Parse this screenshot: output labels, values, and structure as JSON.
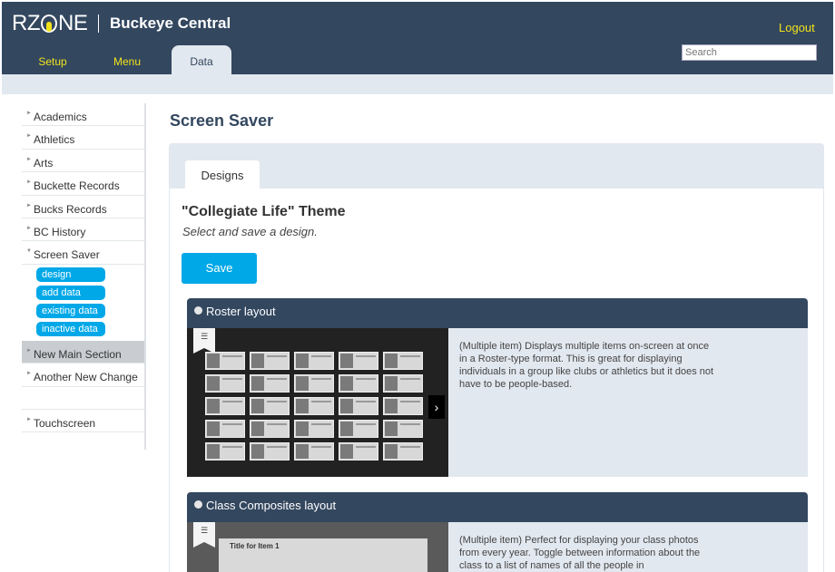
{
  "header": {
    "logo_text": "RZONE",
    "site_title": "Buckeye Central",
    "logout_label": "Logout",
    "search_placeholder": "Search",
    "tabs": [
      {
        "label": "Setup",
        "active": false
      },
      {
        "label": "Menu",
        "active": false
      },
      {
        "label": "Data",
        "active": true
      }
    ],
    "accent_color": "#f2e31b",
    "bar_color": "#33475f"
  },
  "sidebar": {
    "items": [
      {
        "label": "Academics"
      },
      {
        "label": "Athletics"
      },
      {
        "label": "Arts"
      },
      {
        "label": "Buckette Records"
      },
      {
        "label": "Bucks Records"
      },
      {
        "label": "BC History"
      },
      {
        "label": "Screen Saver"
      }
    ],
    "subitems": [
      {
        "label": "design"
      },
      {
        "label": "add data"
      },
      {
        "label": "existing data"
      },
      {
        "label": "inactive data"
      }
    ],
    "after_items": [
      {
        "label": "New Main Section"
      },
      {
        "label": "Another New Change"
      }
    ],
    "bottom_items": [
      {
        "label": "Touchscreen"
      }
    ],
    "chip_color": "#00a8e8"
  },
  "main": {
    "page_title": "Screen Saver",
    "panel_tab": "Designs",
    "theme_title": "\"Collegiate Life\" Theme",
    "theme_subtitle": "Select and save a design.",
    "save_label": "Save",
    "layouts": [
      {
        "title": "Roster layout",
        "description": "(Multiple item) Displays multiple items on-screen at once in a Roster-type format. This is great for displaying individuals in a group like clubs or athletics but it does not have to be people-based."
      },
      {
        "title": "Class Composites layout",
        "description": "(Multiple item) Perfect for displaying your class photos from every year. Toggle between information about the class to a list of names of all the people in",
        "thumb_label": "Title for Item 1"
      }
    ]
  }
}
